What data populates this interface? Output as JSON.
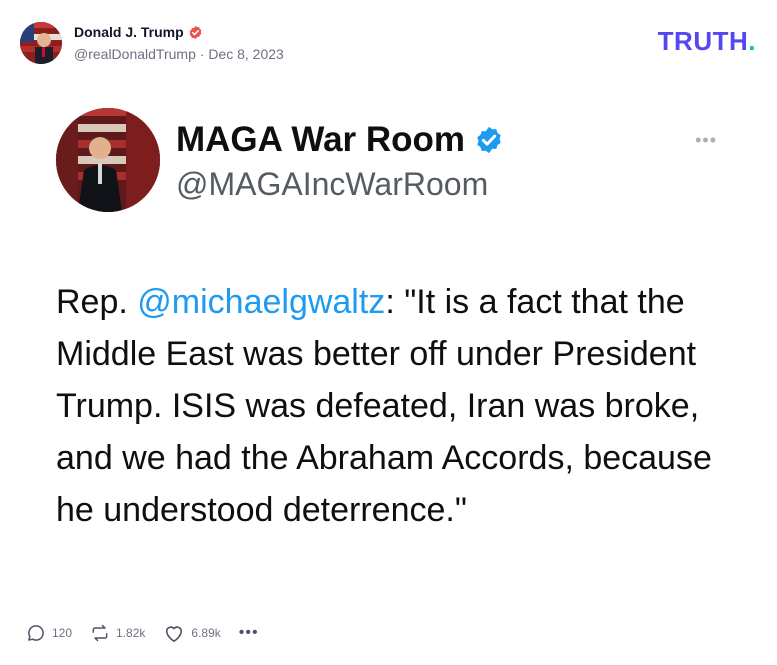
{
  "post": {
    "author_name": "Donald J. Trump",
    "author_handle": "@realDonaldTrump",
    "separator": "·",
    "date": "Dec 8, 2023",
    "verified_icon": "verified-badge-icon",
    "brand": {
      "text": "TRUTH",
      "dot": ".",
      "color": "#5448ee",
      "dot_color": "#18c0a0"
    }
  },
  "embed": {
    "name": "MAGA War Room",
    "handle": "@MAGAIncWarRoom",
    "more_label": "•••",
    "text_prefix": "Rep. ",
    "mention": "@michaelgwaltz",
    "text_body": ": \"It is a fact that the Middle East was better off under President Trump. ISIS was defeated, Iran was broke, and we had the Abraham Accords, because he understood deterrence.\"",
    "mention_color": "#1d9bf0"
  },
  "actions": {
    "replies": "120",
    "reposts": "1.82k",
    "likes": "6.89k",
    "more": "•••"
  }
}
